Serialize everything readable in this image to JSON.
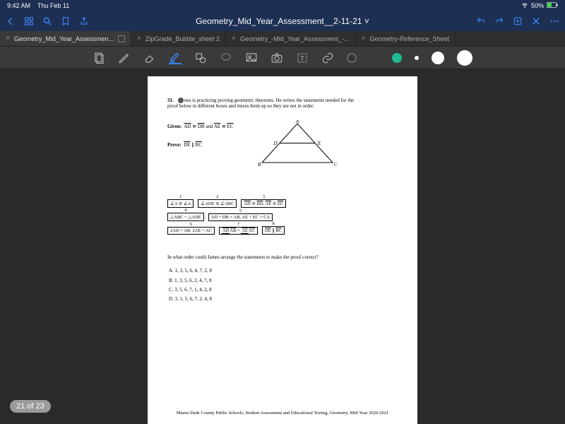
{
  "status": {
    "time": "9:42 AM",
    "date": "Thu Feb 11",
    "battery": "50%"
  },
  "nav": {
    "title": "Geometry_Mid_Year_Assessment__2-11-21 ˅"
  },
  "tabs": [
    {
      "label": "Geometry_Mid_Year_Assessmen...",
      "active": true
    },
    {
      "label": "ZipGrade_Bubble_sheet 2",
      "active": false
    },
    {
      "label": "Geometry_-Mid_Year_Assessment_-...",
      "active": false
    },
    {
      "label": "Geometry-Reference_Sheet",
      "active": false
    }
  ],
  "tools": {
    "colors": {
      "c1": "#333333",
      "c2": "#c4cc33",
      "c3": "#1db894"
    }
  },
  "doc": {
    "qnum": "31.",
    "qtext_a": "nes is practicing proving geometric theorems. He writes the statements needed for the",
    "qtext_b": "proof below in different boxes and mixes them up so they are not in order.",
    "given_label": "Given:",
    "given_text_a": "AD",
    "given_eq1": " ≅ ",
    "given_text_b": "DB",
    "given_and": " and ",
    "given_text_c": "AE",
    "given_eq2": " ≅ ",
    "given_text_d": "EC",
    "prove_label": "Prove:",
    "prove_text_a": "DE",
    "prove_par": " ∥ ",
    "prove_text_b": "BC",
    "tri": {
      "A": "A",
      "B": "B",
      "C": "C",
      "D": "D",
      "E": "E"
    },
    "boxes": {
      "b1": "∠A ≅ ∠A",
      "b2": "∠ADE ≅ ∠ABC",
      "b3_a": "AD",
      "b3_m": " ≅ ",
      "b3_b": "BD",
      "b3_c": ", ",
      "b3_d": "AE",
      "b3_e": " ≅ ",
      "b3_f": "EC",
      "b4": "△ABC ~ △ADE",
      "b5": "AD + DB = AB, AE + EC = CA",
      "b6": "2AD = AB, 2AE = AC",
      "b7_t1": "AD",
      "b7_t2": "AE",
      "b7_b1": "AB",
      "b7_b2": "AC",
      "b7_eq": " = ",
      "b8_a": "DE",
      "b8_m": " ∥ ",
      "b8_b": "BC"
    },
    "question2": "In what order could James arrange the statements to make the proof correct?",
    "choices": {
      "A": "A.   1, 3, 5, 6, 4, 7, 2, 8",
      "B": "B.   1, 3, 5, 6, 2, 4, 7, 8",
      "C": "C.   3, 5, 6, 7, 1, 4, 2, 8",
      "D": "D.   3, 1, 5, 6, 7, 2, 4, 8"
    },
    "footer": "Miami-Dade County Public Schools, Student Assessment and Educational Testing, Geometry, Mid-Year 2020-2021"
  },
  "pager": "21 of 23"
}
